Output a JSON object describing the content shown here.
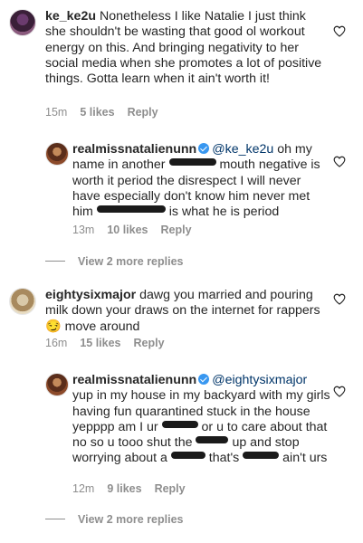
{
  "comments": [
    {
      "username": "ke_ke2u",
      "text": "Nonetheless I like Natalie I just think she shouldn't be wasting that good ol workout energy on this. And bringing negativity to her social media when she promotes a lot of positive things. Gotta learn when it ain't worth it!",
      "time": "15m",
      "likes": "5 likes",
      "reply": "Reply"
    },
    {
      "username": "realmissnatalienunn",
      "mention": "@ke_ke2u",
      "text_a": "oh my name in another",
      "text_b": "mouth negative is worth it period the disrespect I will never have especially don't know him never met him",
      "text_c": "is what he is period",
      "time": "13m",
      "likes": "10 likes",
      "reply": "Reply"
    },
    {
      "view_more": "View 2 more replies"
    },
    {
      "username": "eightysixmajor",
      "text": "dawg you married and pouring milk down your draws on the internet for rappers",
      "emoji": "😏",
      "text_end": "move around",
      "time": "16m",
      "likes": "15 likes",
      "reply": "Reply"
    },
    {
      "username": "realmissnatalienunn",
      "mention": "@eightysixmajor",
      "text_a": "yup in my house in my backyard with my girls having fun quarantined stuck in the house yepppp am I ur",
      "text_b": "or u to care about that no so u tooo shut the",
      "text_c": "up and stop worrying about a",
      "text_d": "that's",
      "text_e": "ain't urs",
      "time": "12m",
      "likes": "9 likes",
      "reply": "Reply"
    },
    {
      "view_more": "View 2 more replies"
    }
  ],
  "icons": {
    "like": "heart-outline-icon",
    "verified": "verified-badge-icon"
  },
  "colors": {
    "text": "#262626",
    "meta": "#8e8e8e",
    "verified": "#3897f0",
    "mention": "#003569"
  }
}
